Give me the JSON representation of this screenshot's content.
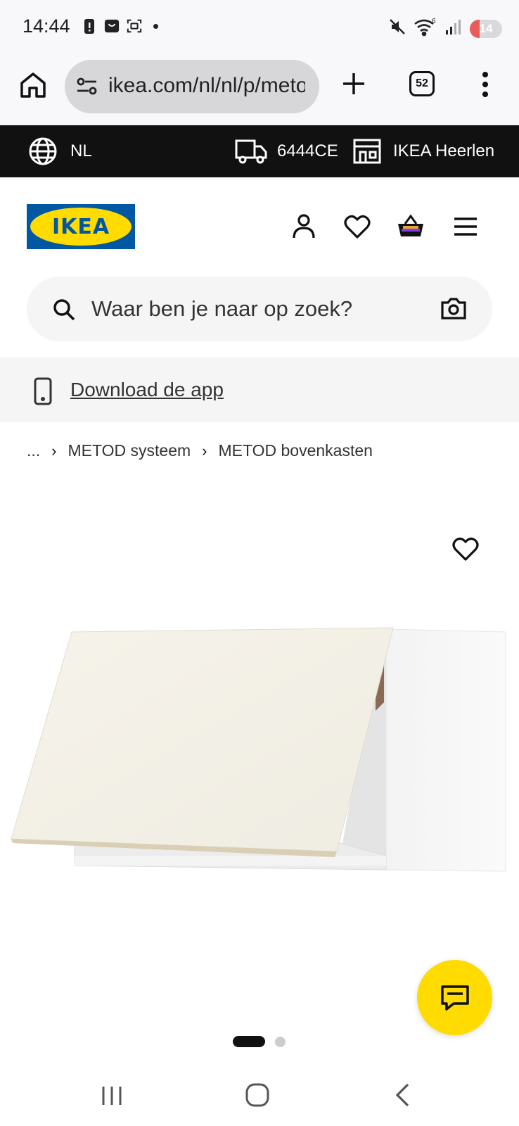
{
  "status_bar": {
    "time": "14:44",
    "battery": "14",
    "icons": [
      "battery-alert-icon",
      "bag-icon",
      "screenshot-icon",
      "mute-icon",
      "wifi-icon",
      "signal-icon"
    ]
  },
  "browser": {
    "url": "ikea.com/nl/nl/p/metod",
    "tab_count": "52"
  },
  "topbar": {
    "language": "NL",
    "postcode": "6444CE",
    "store": "IKEA Heerlen"
  },
  "header": {
    "logo_text": "IKEA"
  },
  "search": {
    "placeholder": "Waar ben je naar op zoek?"
  },
  "app_banner": {
    "label": "Download de app"
  },
  "breadcrumb": {
    "ellipsis": "...",
    "items": [
      "METOD systeem",
      "METOD bovenkasten"
    ]
  },
  "carousel": {
    "current": 1,
    "total": 2
  },
  "colors": {
    "ikea_blue": "#0058a3",
    "ikea_yellow": "#ffdb00",
    "topbar_bg": "#111111"
  }
}
